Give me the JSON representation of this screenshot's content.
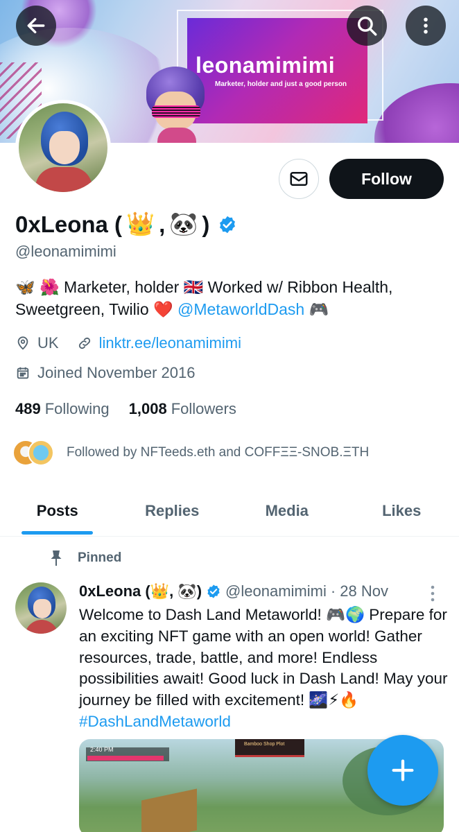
{
  "banner": {
    "title": "leonamimimi",
    "subtitle": "Marketer, holder and just a good person"
  },
  "header_icons": {
    "back": "arrow-left-icon",
    "search": "search-icon",
    "more": "more-vertical-icon"
  },
  "profile": {
    "display_name": "0xLeona (",
    "display_name_sep": ", ",
    "display_name_end": ")",
    "emoji_1": "👑",
    "emoji_2": "🐼",
    "handle": "@leonamimimi",
    "verified": true,
    "follow_label": "Follow",
    "bio_prefix": "🦋 🌺 Marketer, holder 🇬🇧 Worked w/ Ribbon Health, Sweetgreen, Twilio ❤️ ",
    "bio_link": "@MetaworldDash",
    "bio_suffix": " 🎮",
    "location": "UK",
    "website": "linktr.ee/leonamimimi",
    "joined": "Joined November 2016",
    "following_count": "489",
    "following_label": "Following",
    "followers_count": "1,008",
    "followers_label": "Followers",
    "followed_by": "Followed by NFTeeds.eth and COFFΞΞ-SNOB.ΞTH"
  },
  "tabs": [
    {
      "label": "Posts",
      "active": true
    },
    {
      "label": "Replies",
      "active": false
    },
    {
      "label": "Media",
      "active": false
    },
    {
      "label": "Likes",
      "active": false
    }
  ],
  "pinned_tweet": {
    "pinned_label": "Pinned",
    "name": "0xLeona (👑, 🐼)",
    "handle": "@leonamimimi",
    "date": "· 28 Nov",
    "text": "Welcome to Dash Land Metaworld! 🎮🌍 Prepare for an exciting NFT game with an open world! Gather resources, trade, battle, and more! Endless possibilities await! Good luck in Dash Land! May your journey be filled with excitement! 🌌⚡🔥 ",
    "hashtag": "#DashLandMetaworld",
    "media_time": "2:40 PM",
    "media_sign": "Bamboo Shop Plot"
  },
  "colors": {
    "accent": "#1d9bf0",
    "text": "#0f1419",
    "secondary": "#536471"
  }
}
